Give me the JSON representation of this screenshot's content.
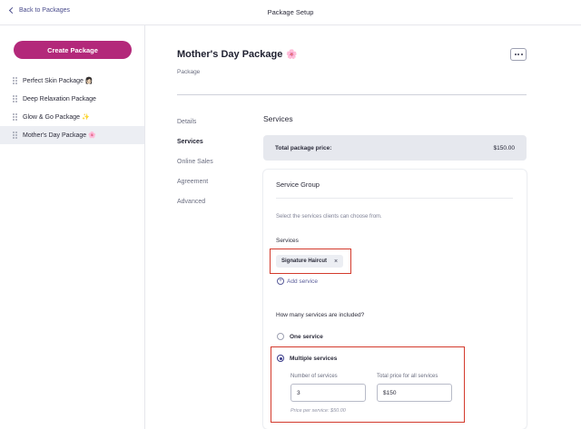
{
  "header": {
    "back_label": "Back to Packages",
    "title": "Package Setup"
  },
  "sidebar": {
    "create_button": "Create Package",
    "packages": [
      {
        "label": "Perfect Skin Package 👩🏻",
        "active": false
      },
      {
        "label": "Deep Relaxation Package",
        "active": false
      },
      {
        "label": "Glow & Go Package ✨",
        "active": false
      },
      {
        "label": "Mother's Day Package 🌸",
        "active": true
      }
    ]
  },
  "main": {
    "title": "Mother's Day Package",
    "title_emoji": "🌸",
    "subtitle": "Package",
    "more_button": "more options"
  },
  "section_nav": {
    "items": [
      "Details",
      "Services",
      "Online Sales",
      "Agreement",
      "Advanced"
    ],
    "active": "Services"
  },
  "services": {
    "heading": "Services",
    "total_label": "Total package price:",
    "total_value": "$150.00",
    "group": {
      "title": "Service Group",
      "description": "Select the services clients can choose from.",
      "services_label": "Services",
      "chip_label": "Signature Haircut",
      "chip_remove": "×",
      "add_service": "Add service",
      "question": "How many services are included?",
      "option_one": "One service",
      "option_multiple": "Multiple services",
      "selected_option": "Multiple services",
      "number_label": "Number of services",
      "number_value": "3",
      "total_price_label": "Total price for all services",
      "total_price_value": "$150",
      "price_per_service": "Price per service: $50.00"
    }
  },
  "colors": {
    "brand": "#b3287a",
    "accent": "#3a3c8a",
    "highlight_box": "#d33a2c"
  }
}
